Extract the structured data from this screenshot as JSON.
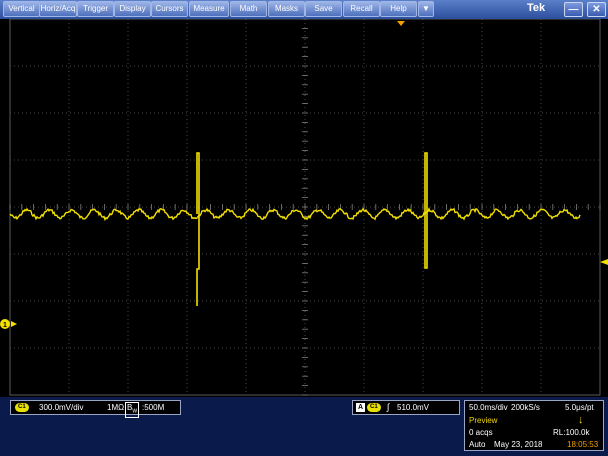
{
  "menu": {
    "vertical": "Vertical",
    "horiz": "Horiz/Acq",
    "trigger": "Trigger",
    "display": "Display",
    "cursors": "Cursors",
    "measure": "Measure",
    "math": "Math",
    "masks": "Masks",
    "save": "Save",
    "recall": "Recall",
    "help": "Help",
    "dropdown_glyph": "▼",
    "brand": "Tek",
    "minimize_glyph": "—",
    "close_glyph": "✕"
  },
  "colors": {
    "trace": "#f2e000",
    "grid": "#5a5a5a",
    "menubar": "#3a5eb0"
  },
  "channel": {
    "badge": "C1",
    "scale": "300.0mV/div",
    "impedance": "1MΩ",
    "bw_prefix": "B",
    "bw_sub": "W",
    "bandwidth": ":500M",
    "marker": "1"
  },
  "trigger": {
    "mode_badge": "A",
    "source_badge": "C1",
    "slope_glyph": "∫",
    "level": "510.0mV"
  },
  "horizontal": {
    "timebase": "50.0ms/div",
    "sample_rate": "200kS/s",
    "resolution": "5.0μs/pt",
    "state": "Preview",
    "acqs": "0 acqs",
    "record_length": "RL:100.0k",
    "trigger_mode": "Auto",
    "date": "May 23, 2018",
    "time": "18:05:53"
  }
}
